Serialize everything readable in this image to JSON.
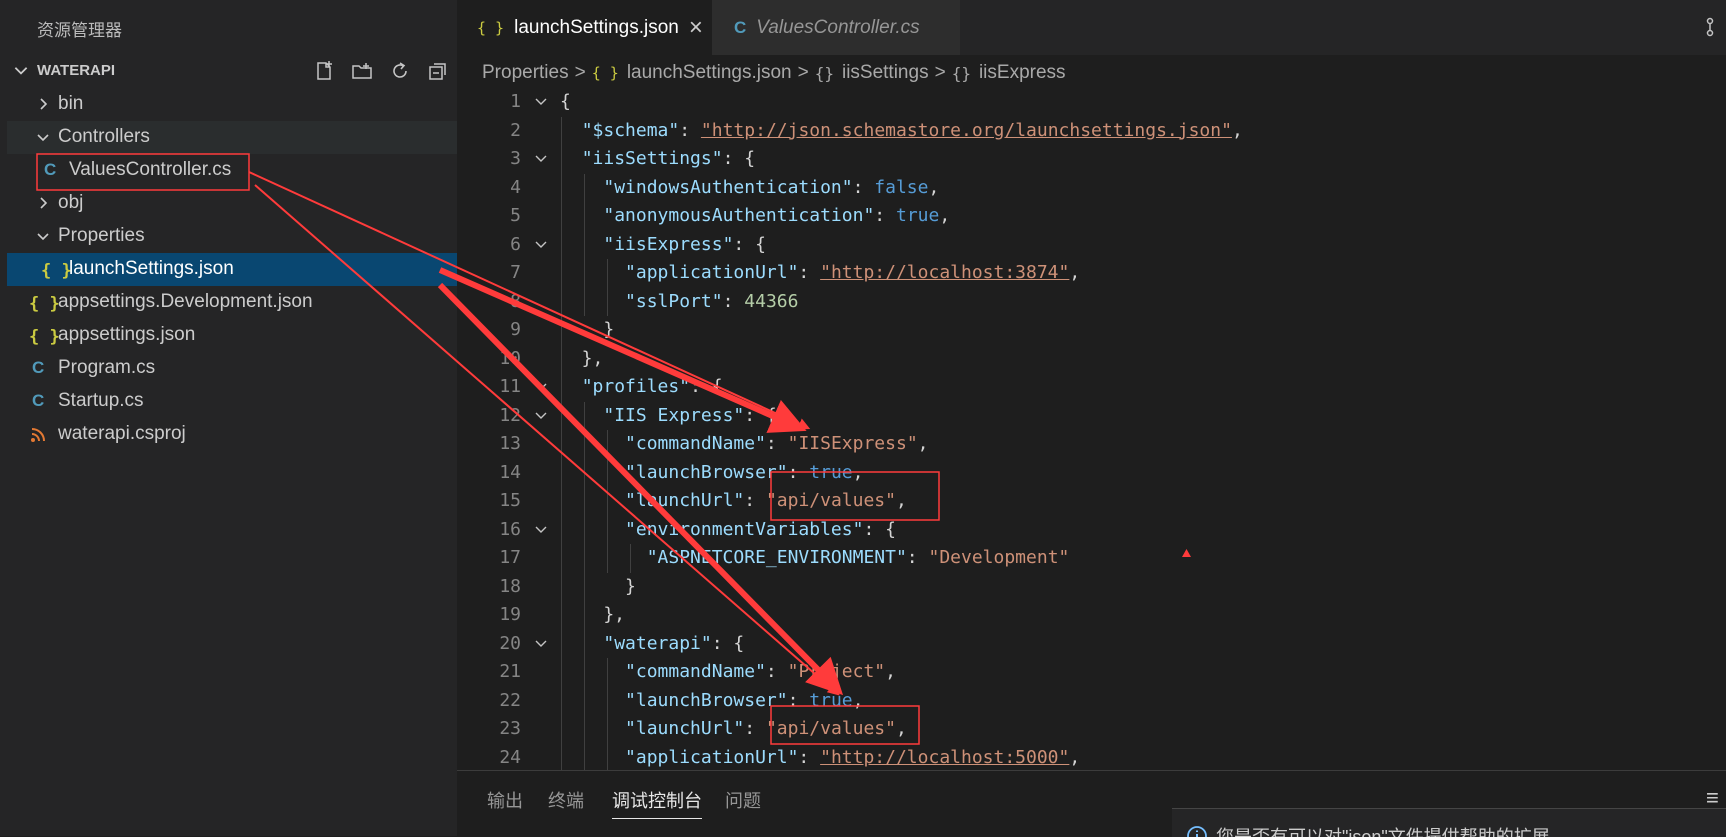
{
  "sidebar": {
    "title": "资源管理器",
    "section": "WATERAPI",
    "tree": [
      {
        "label": "bin",
        "icon": "chevron-right-icon"
      },
      {
        "label": "Controllers",
        "icon": "chevron-down-icon"
      },
      {
        "label": "ValuesController.cs",
        "icon": "csharp-file-icon"
      },
      {
        "label": "obj",
        "icon": "chevron-right-icon"
      },
      {
        "label": "Properties",
        "icon": "chevron-down-icon"
      },
      {
        "label": "launchSettings.json",
        "icon": "json-file-icon"
      },
      {
        "label": "appsettings.Development.json",
        "icon": "json-file-icon"
      },
      {
        "label": "appsettings.json",
        "icon": "json-file-icon"
      },
      {
        "label": "Program.cs",
        "icon": "csharp-file-icon"
      },
      {
        "label": "Startup.cs",
        "icon": "csharp-file-icon"
      },
      {
        "label": "waterapi.csproj",
        "icon": "rss-file-icon"
      }
    ],
    "icon_glyphs": {
      "json": "{ }",
      "csharp": "C"
    }
  },
  "tabs": [
    {
      "label": "launchSettings.json",
      "close": "×"
    },
    {
      "label": "ValuesController.cs"
    }
  ],
  "breadcrumb": {
    "items": [
      "Properties",
      "launchSettings.json",
      "iisSettings",
      "iisExpress"
    ],
    "separator": ">",
    "icon_glyph": "{ }",
    "object_glyph": "{}"
  },
  "code_lines": [
    {
      "n": "1",
      "fold": true,
      "tokens": [
        [
          "p",
          "{"
        ]
      ]
    },
    {
      "n": "2",
      "tokens": [
        [
          "p",
          "  "
        ],
        [
          "k",
          "\"$schema\""
        ],
        [
          "p",
          ": "
        ],
        [
          "s",
          "\"http://json.schemastore.org/launchsettings.json\""
        ],
        [
          "p",
          ","
        ]
      ]
    },
    {
      "n": "3",
      "fold": true,
      "tokens": [
        [
          "p",
          "  "
        ],
        [
          "k",
          "\"iisSettings\""
        ],
        [
          "p",
          ": {"
        ]
      ]
    },
    {
      "n": "4",
      "tokens": [
        [
          "p",
          "    "
        ],
        [
          "k",
          "\"windowsAuthentication\""
        ],
        [
          "p",
          ": "
        ],
        [
          "b",
          "false"
        ],
        [
          "p",
          ","
        ]
      ]
    },
    {
      "n": "5",
      "tokens": [
        [
          "p",
          "    "
        ],
        [
          "k",
          "\"anonymousAuthentication\""
        ],
        [
          "p",
          ": "
        ],
        [
          "b",
          "true"
        ],
        [
          "p",
          ","
        ]
      ]
    },
    {
      "n": "6",
      "fold": true,
      "tokens": [
        [
          "p",
          "    "
        ],
        [
          "k",
          "\"iisExpress\""
        ],
        [
          "p",
          ": {"
        ]
      ]
    },
    {
      "n": "7",
      "tokens": [
        [
          "p",
          "      "
        ],
        [
          "k",
          "\"applicationUrl\""
        ],
        [
          "p",
          ": "
        ],
        [
          "s",
          "\"http://localhost:3874\""
        ],
        [
          "p",
          ","
        ]
      ]
    },
    {
      "n": "8",
      "tokens": [
        [
          "p",
          "      "
        ],
        [
          "k",
          "\"sslPort\""
        ],
        [
          "p",
          ": "
        ],
        [
          "n",
          "44366"
        ]
      ]
    },
    {
      "n": "9",
      "tokens": [
        [
          "p",
          "    }"
        ]
      ]
    },
    {
      "n": "10",
      "tokens": [
        [
          "p",
          "  },"
        ]
      ]
    },
    {
      "n": "11",
      "fold": true,
      "tokens": [
        [
          "p",
          "  "
        ],
        [
          "k",
          "\"profiles\""
        ],
        [
          "p",
          ": {"
        ]
      ]
    },
    {
      "n": "12",
      "fold": true,
      "tokens": [
        [
          "p",
          "    "
        ],
        [
          "k",
          "\"IIS Express\""
        ],
        [
          "p",
          ": {"
        ]
      ]
    },
    {
      "n": "13",
      "tokens": [
        [
          "p",
          "      "
        ],
        [
          "k",
          "\"commandName\""
        ],
        [
          "p",
          ": "
        ],
        [
          "s",
          "\"IISExpress\""
        ],
        [
          "p",
          ","
        ]
      ]
    },
    {
      "n": "14",
      "tokens": [
        [
          "p",
          "      "
        ],
        [
          "k",
          "\"launchBrowser\""
        ],
        [
          "p",
          ": "
        ],
        [
          "b",
          "true"
        ],
        [
          "p",
          ","
        ]
      ]
    },
    {
      "n": "15",
      "tokens": [
        [
          "p",
          "      "
        ],
        [
          "k",
          "\"launchUrl\""
        ],
        [
          "p",
          ": "
        ],
        [
          "s",
          "\"api/values\""
        ],
        [
          "p",
          ","
        ]
      ]
    },
    {
      "n": "16",
      "fold": true,
      "tokens": [
        [
          "p",
          "      "
        ],
        [
          "k",
          "\"environmentVariables\""
        ],
        [
          "p",
          ": {"
        ]
      ]
    },
    {
      "n": "17",
      "tokens": [
        [
          "p",
          "        "
        ],
        [
          "k",
          "\"ASPNETCORE_ENVIRONMENT\""
        ],
        [
          "p",
          ": "
        ],
        [
          "s",
          "\"Development\""
        ]
      ]
    },
    {
      "n": "18",
      "tokens": [
        [
          "p",
          "      }"
        ]
      ]
    },
    {
      "n": "19",
      "tokens": [
        [
          "p",
          "    },"
        ]
      ]
    },
    {
      "n": "20",
      "fold": true,
      "tokens": [
        [
          "p",
          "    "
        ],
        [
          "k",
          "\"waterapi\""
        ],
        [
          "p",
          ": {"
        ]
      ]
    },
    {
      "n": "21",
      "tokens": [
        [
          "p",
          "      "
        ],
        [
          "k",
          "\"commandName\""
        ],
        [
          "p",
          ": "
        ],
        [
          "s",
          "\"Project\""
        ],
        [
          "p",
          ","
        ]
      ]
    },
    {
      "n": "22",
      "tokens": [
        [
          "p",
          "      "
        ],
        [
          "k",
          "\"launchBrowser\""
        ],
        [
          "p",
          ": "
        ],
        [
          "b",
          "true"
        ],
        [
          "p",
          ","
        ]
      ]
    },
    {
      "n": "23",
      "tokens": [
        [
          "p",
          "      "
        ],
        [
          "k",
          "\"launchUrl\""
        ],
        [
          "p",
          ": "
        ],
        [
          "s",
          "\"api/values\""
        ],
        [
          "p",
          ","
        ]
      ]
    },
    {
      "n": "24",
      "tokens": [
        [
          "p",
          "      "
        ],
        [
          "k",
          "\"applicationUrl\""
        ],
        [
          "p",
          ": "
        ],
        [
          "s",
          "\"http://localhost:5000\""
        ],
        [
          "p",
          ","
        ]
      ]
    }
  ],
  "panel": {
    "tabs": [
      "输出",
      "终端",
      "调试控制台",
      "问题"
    ],
    "active_tab": "调试控制台",
    "menu_glyph": "≡"
  },
  "notification": {
    "text": "您是否有可以对\"json\"文件提供帮助的扩展",
    "icon": "info-icon"
  },
  "colors": {
    "annotation": "#ff3b3b",
    "selected_row": "#094771",
    "key": "#9cdcfe",
    "string": "#ce9178",
    "keyword": "#569cd6",
    "number": "#b5cea8"
  }
}
